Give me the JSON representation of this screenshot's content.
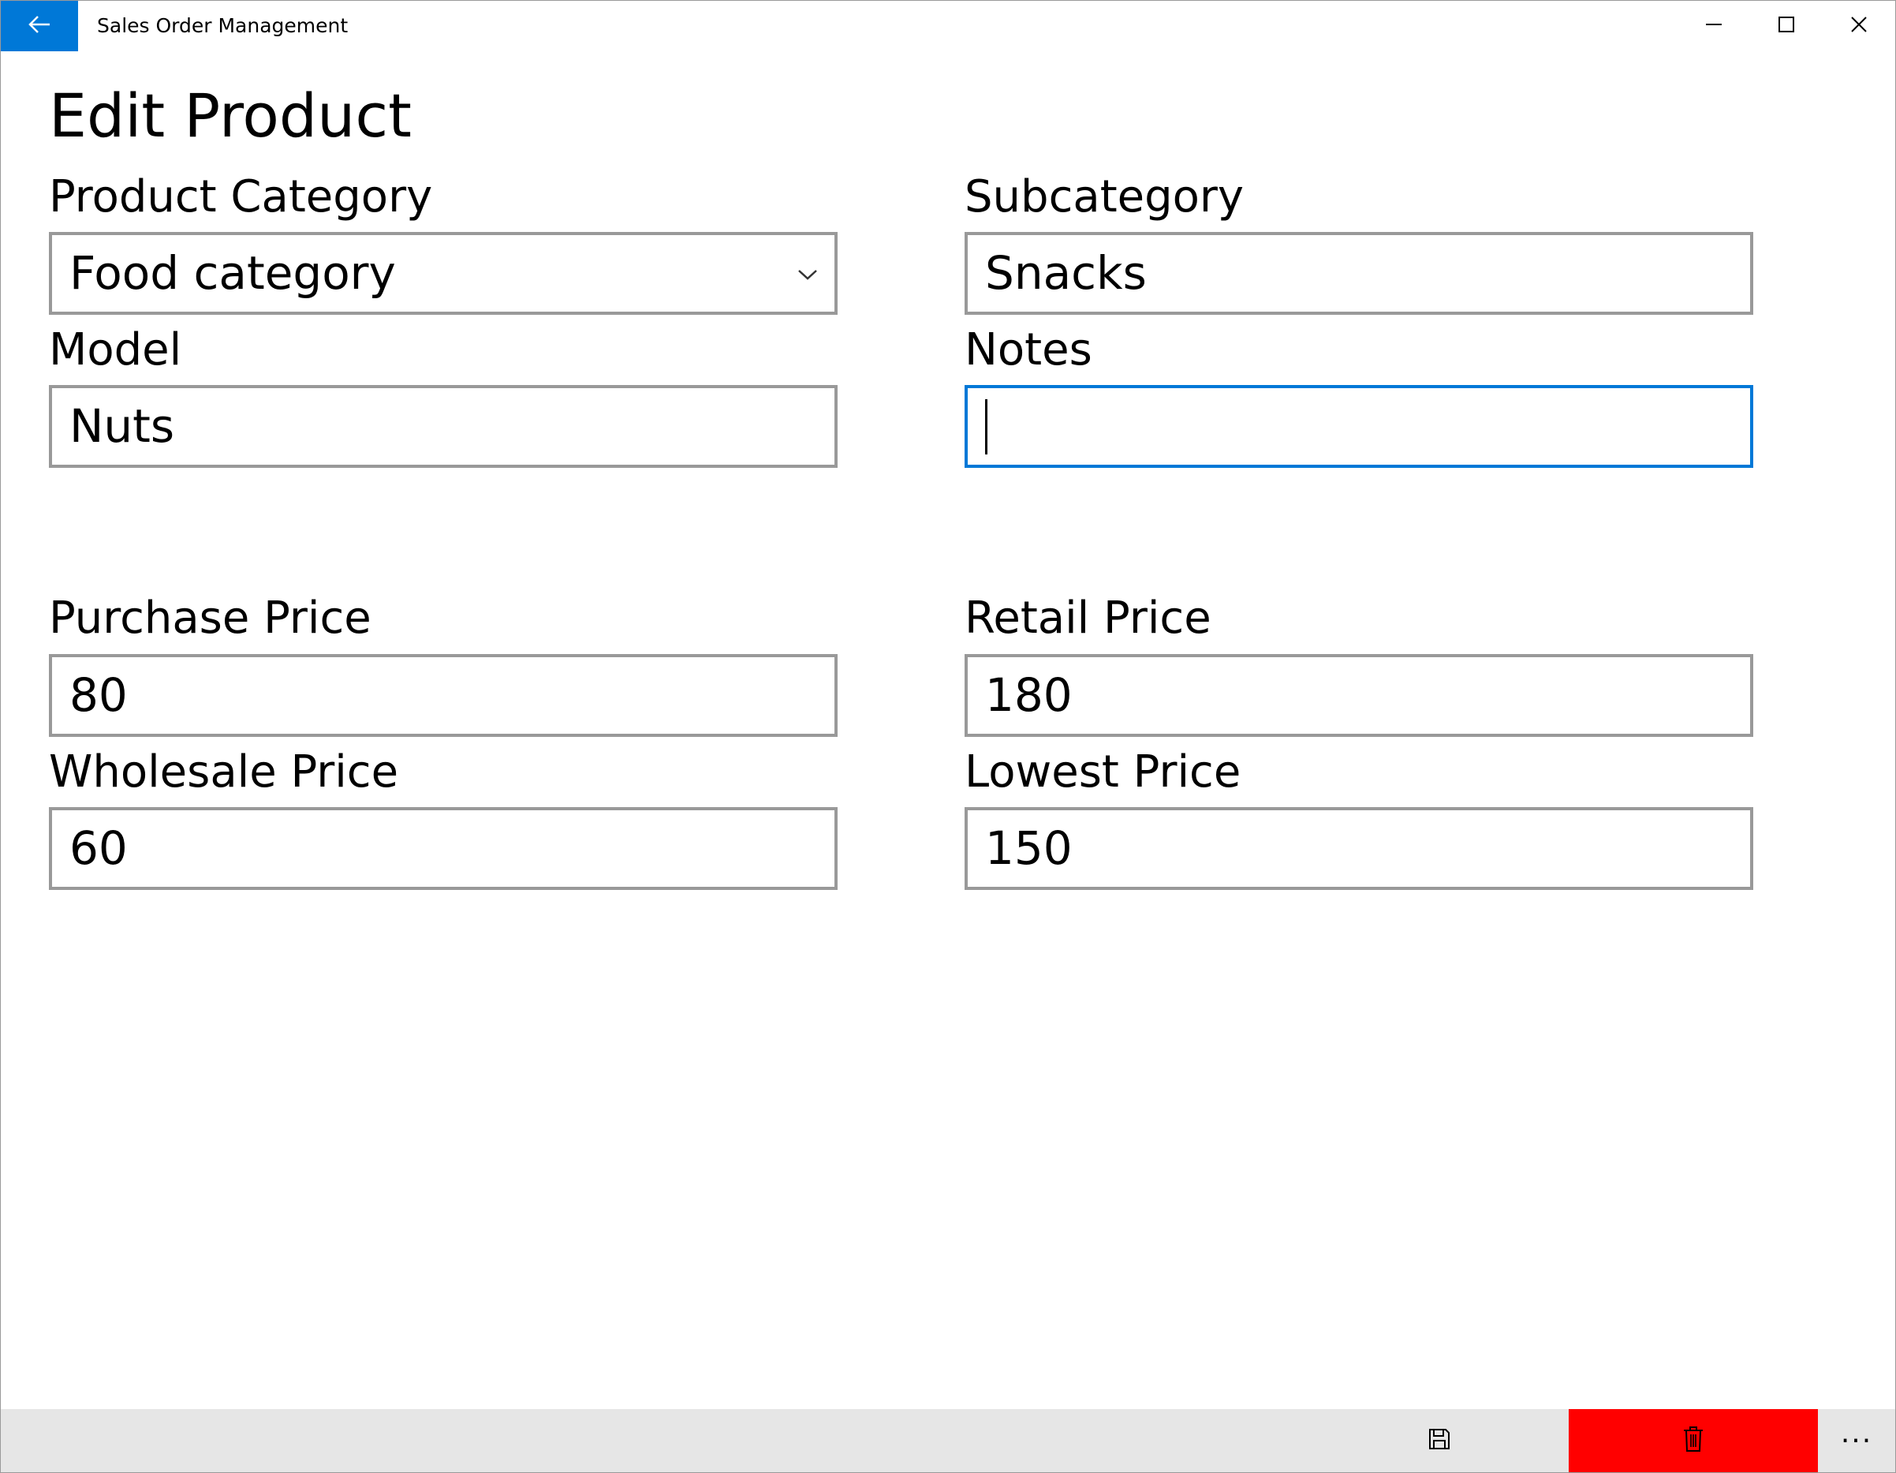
{
  "window": {
    "title": "Sales Order Management",
    "accent_color": "#0078d7"
  },
  "titlebar": {
    "back_icon": "arrow-left-icon",
    "minimize_icon": "minimize-icon",
    "maximize_icon": "maximize-icon",
    "close_icon": "close-icon"
  },
  "page": {
    "title": "Edit Product"
  },
  "form": {
    "product_category": {
      "label": "Product Category",
      "value": "Food category"
    },
    "subcategory": {
      "label": "Subcategory",
      "value": "Snacks"
    },
    "model": {
      "label": "Model",
      "value": "Nuts"
    },
    "notes": {
      "label": "Notes",
      "value": ""
    },
    "purchase_price": {
      "label": "Purchase Price",
      "value": "80"
    },
    "retail_price": {
      "label": "Retail Price",
      "value": "180"
    },
    "wholesale_price": {
      "label": "Wholesale Price",
      "value": "60"
    },
    "lowest_price": {
      "label": "Lowest Price",
      "value": "150"
    }
  },
  "commandbar": {
    "save_icon": "save-icon",
    "delete_icon": "delete-icon",
    "delete_color": "#ff0000",
    "more_label": "···"
  }
}
